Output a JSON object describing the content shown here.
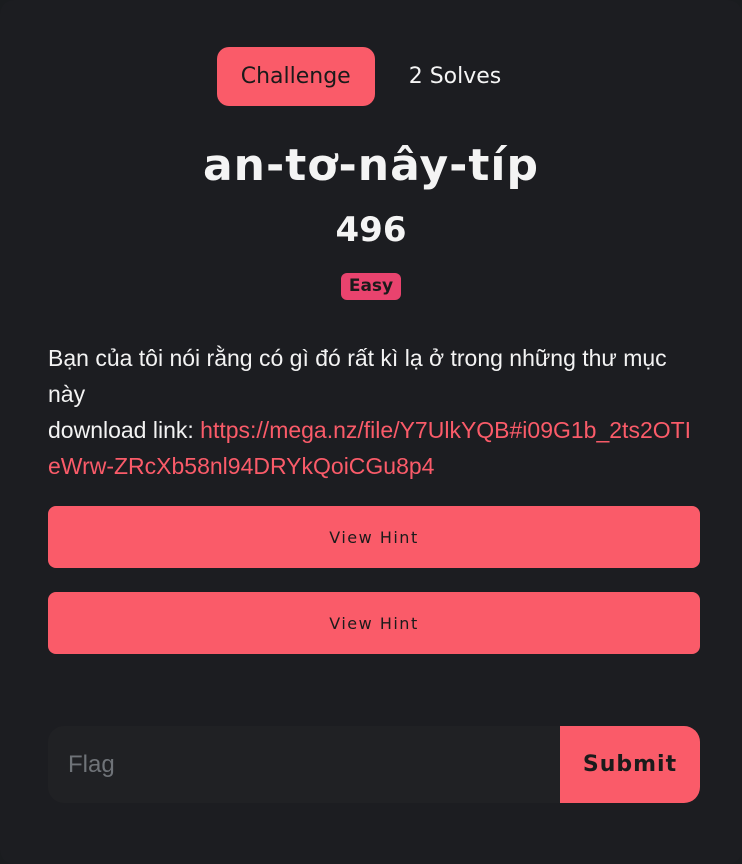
{
  "tabs": [
    {
      "label": "Challenge",
      "active": true
    },
    {
      "label": "2 Solves",
      "active": false
    }
  ],
  "challenge": {
    "name": "an-tơ-nây-típ",
    "points": "496",
    "difficulty": "Easy",
    "description": "Bạn của tôi nói rằng có gì đó rất kì lạ ở trong những thư mục này",
    "download_prefix": "download link: ",
    "download_link": "https://mega.nz/file/Y7UlkYQB#i09G1b_2ts2OTIeWrw-ZRcXb58nl94DRYkQoiCGu8p4"
  },
  "hints": [
    {
      "label": "View Hint"
    },
    {
      "label": "View Hint"
    }
  ],
  "flag_form": {
    "placeholder": "Flag",
    "value": "",
    "submit_label": "Submit"
  },
  "colors": {
    "accent": "#fa5b69",
    "tag": "#e9436e",
    "background": "#1c1d21"
  }
}
